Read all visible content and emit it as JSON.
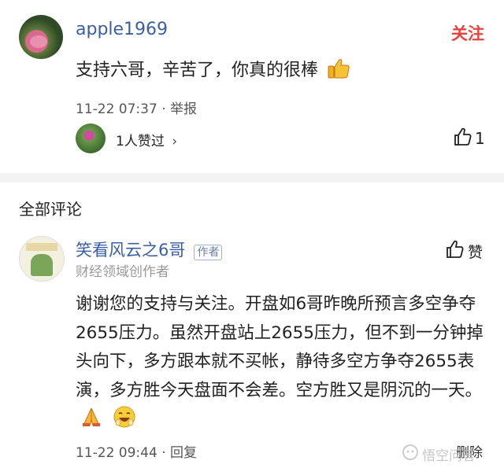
{
  "top_comment": {
    "username": "apple1969",
    "follow_label": "关注",
    "text": "支持六哥，辛苦了，你真的很棒",
    "emoji": "thumbs-up",
    "time": "11-22 07:37",
    "report_label": "举报",
    "likes_summary": "1人赞过",
    "likes_arrow": "›",
    "like_count": "1"
  },
  "section": {
    "title": "全部评论"
  },
  "reply": {
    "username": "笑看风云之6哥",
    "author_badge": "作者",
    "subtitle": "财经领域创作者",
    "like_label": "赞",
    "text": "谢谢您的支持与关注。开盘如6哥昨晚所预言多空争夺2655压力。虽然开盘站上2655压力，但不到一分钟掉头向下，多方跟本就不买帐，静待多空方争夺2655表演，多方胜今天盘面不会差。空方胜又是阴沉的一天。",
    "time": "11-22 09:44",
    "reply_label": "回复",
    "delete_label": "删除"
  },
  "watermark": {
    "text": "悟空问答"
  },
  "colors": {
    "username": "#3a5ea6",
    "follow": "#e8433a",
    "meta": "#555555"
  }
}
